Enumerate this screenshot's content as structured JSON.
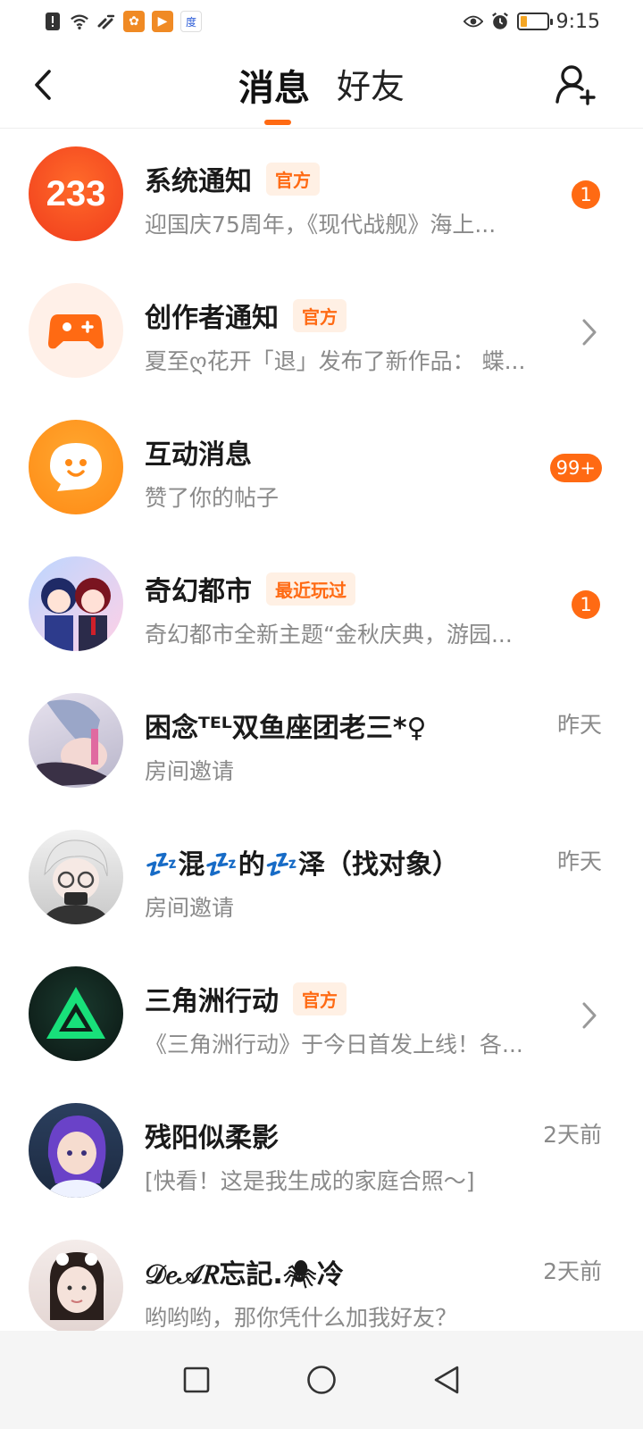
{
  "status_bar": {
    "time": "9:15",
    "left_icons": [
      "alert-icon",
      "wifi-icon",
      "signal-off-icon",
      "app-icon-1",
      "app-icon-2",
      "baidu-icon"
    ],
    "right_icons": [
      "eye-icon",
      "alarm-icon",
      "battery-icon"
    ]
  },
  "header": {
    "tabs": [
      {
        "label": "消息",
        "active": true
      },
      {
        "label": "好友",
        "active": false
      }
    ],
    "accent_color": "#ff6a13"
  },
  "conversations": [
    {
      "name": "系统通知",
      "tag": "官方",
      "preview": "迎国庆75周年，《现代战舰》海上...",
      "badge": "1",
      "time": "",
      "chevron": false,
      "avatar": "233-logo"
    },
    {
      "name": "创作者通知",
      "tag": "官方",
      "preview": "夏至ღ花开「退」发布了新作品：  蝶...",
      "badge": "",
      "time": "",
      "chevron": true,
      "avatar": "gamepad-icon"
    },
    {
      "name": "互动消息",
      "tag": "",
      "preview": "赞了你的帖子",
      "badge": "99+",
      "time": "",
      "chevron": false,
      "avatar": "chat-smile-icon"
    },
    {
      "name": "奇幻都市",
      "tag": "最近玩过",
      "preview": "奇幻都市全新主题“金秋庆典，游园...",
      "badge": "1",
      "time": "",
      "chevron": false,
      "avatar": "anime-duo"
    },
    {
      "name": "困念ᵀᴱᴸ双鱼座团老三*♀",
      "tag": "",
      "preview": "房间邀请",
      "badge": "",
      "time": "昨天",
      "chevron": false,
      "avatar": "anime-girl"
    },
    {
      "name": "💤混💤的💤泽（找对象）",
      "tag": "",
      "preview": "房间邀请",
      "badge": "",
      "time": "昨天",
      "chevron": false,
      "avatar": "white-hair-boy"
    },
    {
      "name": "三角洲行动",
      "tag": "官方",
      "preview": "《三角洲行动》于今日首发上线！各...",
      "badge": "",
      "time": "",
      "chevron": true,
      "avatar": "delta-logo"
    },
    {
      "name": "残阳似柔影",
      "tag": "",
      "preview": "[快看！这是我生成的家庭合照～]",
      "badge": "",
      "time": "2天前",
      "chevron": false,
      "avatar": "purple-hair"
    },
    {
      "name": "𝒟𝑒𝒜𝑅忘記.🕷冷",
      "tag": "",
      "preview": "哟哟哟，那你凭什么加我好友？",
      "badge": "",
      "time": "2天前",
      "chevron": false,
      "avatar": "photo-girl"
    }
  ],
  "nav_bar": {
    "buttons": [
      "recents-icon",
      "home-icon",
      "back-icon"
    ]
  }
}
